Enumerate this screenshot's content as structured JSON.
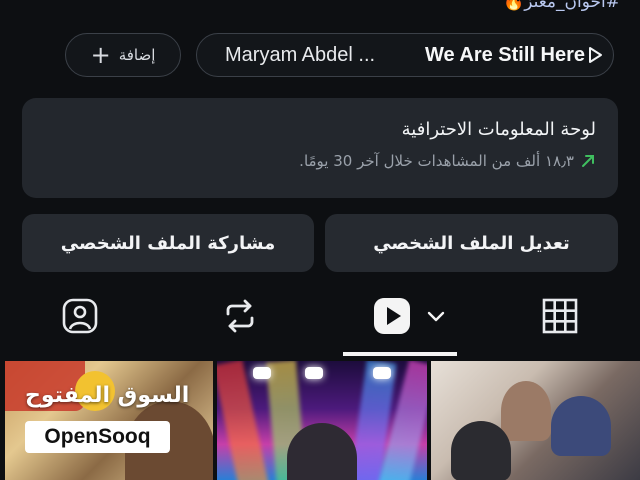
{
  "header": {
    "hashtag": "#اخوان_معتز🔥"
  },
  "music_row": {
    "add_label": "إضافة",
    "artist": "Maryam Abdel ...",
    "song": "We Are Still Here"
  },
  "dashboard": {
    "title": "لوحة المعلومات الاحترافية",
    "stats": "١٨٫٣ ألف من المشاهدات خلال آخر 30 يومًا.",
    "trend_color": "#3fbf5f"
  },
  "actions": {
    "edit_profile": "تعديل الملف الشخصي",
    "share_profile": "مشاركة الملف الشخصي"
  },
  "tabs": [
    {
      "icon": "tagged-person-icon"
    },
    {
      "icon": "repost-icon"
    },
    {
      "icon": "reels-play-icon",
      "selected": true
    },
    {
      "icon": "grid-icon"
    }
  ],
  "watermark": {
    "arabic": "السوق المفتوح",
    "english": "OpenSooq"
  }
}
